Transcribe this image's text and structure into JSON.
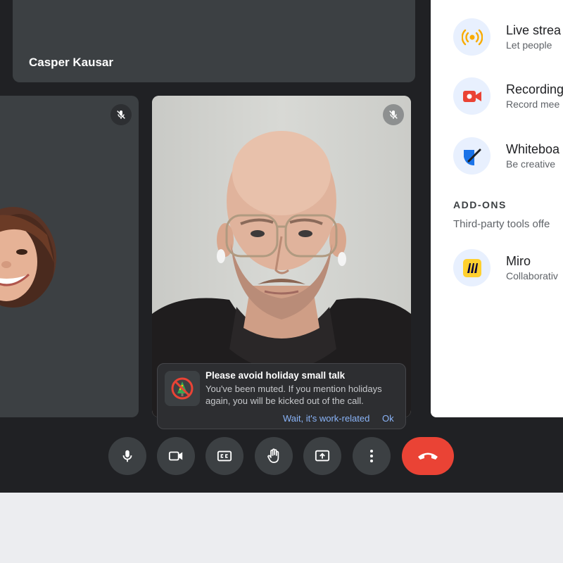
{
  "participants": {
    "top": {
      "name": "Casper Kausar"
    }
  },
  "activities": {
    "items": [
      {
        "title": "Live strea",
        "subtitle": "Let people",
        "icon": "live-stream-icon"
      },
      {
        "title": "Recording",
        "subtitle": "Record mee",
        "icon": "recording-icon"
      },
      {
        "title": "Whiteboa",
        "subtitle": "Be creative",
        "icon": "whiteboard-icon"
      }
    ],
    "addons": {
      "heading": "ADD-ONS",
      "description": "Third-party tools offe",
      "items": [
        {
          "title": "Miro",
          "subtitle": "Collaborativ",
          "icon": "miro-icon"
        }
      ]
    }
  },
  "toast": {
    "title": "Please avoid holiday small talk",
    "body": "You've been muted. If you mention holidays again, you will be kicked out of the call.",
    "action_secondary": "Wait, it's work-related",
    "action_primary": "Ok",
    "icon": "no-holiday-icon"
  },
  "controls": {
    "icons": [
      "microphone-icon",
      "camera-icon",
      "captions-icon",
      "raise-hand-icon",
      "present-icon",
      "more-options-icon",
      "end-call-icon"
    ]
  },
  "colors": {
    "call_background": "#202124",
    "tile_background": "#3c4043",
    "end_call": "#ea4335",
    "link": "#8ab4f8",
    "panel_background": "#ffffff"
  }
}
